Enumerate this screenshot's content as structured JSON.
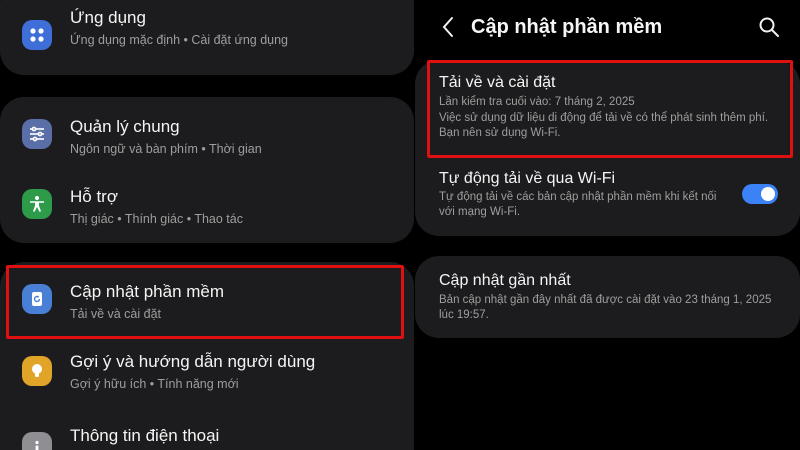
{
  "left": {
    "items": [
      {
        "title": "Ứng dụng",
        "subtitle": "Ứng dụng mặc định • Cài đặt ứng dụng"
      },
      {
        "title": "Quản lý chung",
        "subtitle": "Ngôn ngữ và bàn phím • Thời gian"
      },
      {
        "title": "Hỗ trợ",
        "subtitle": "Thị giác • Thính giác • Thao tác"
      },
      {
        "title": "Cập nhật phần mềm",
        "subtitle": "Tải về và cài đặt"
      },
      {
        "title": "Gợi ý và hướng dẫn người dùng",
        "subtitle": "Gợi ý hữu ích • Tính năng mới"
      },
      {
        "title": "Thông tin điện thoại",
        "subtitle": ""
      }
    ]
  },
  "right": {
    "page_title": "Cập nhật phần mềm",
    "download": {
      "title": "Tải về và cài đặt",
      "last_check": "Lần kiểm tra cuối vào: 7 tháng 2, 2025",
      "note": "Việc sử dụng dữ liệu di động để tải về có thể phát sinh thêm phí. Bạn nên sử dụng Wi-Fi."
    },
    "auto": {
      "title": "Tự động tải về qua Wi-Fi",
      "desc": "Tự động tải về các bản cập nhật phần mềm khi kết nối với mạng Wi-Fi.",
      "toggle_on": true
    },
    "latest": {
      "title": "Cập nhật gần nhất",
      "desc": "Bản cập nhật gần đây nhất đã được cài đặt vào 23 tháng 1, 2025 lúc 19:57."
    }
  },
  "colors": {
    "highlight": "#e01010",
    "apps_icon": "#3e6fd8",
    "general_icon": "#5a6fa8",
    "support_icon": "#2e9b4a",
    "update_icon": "#4a7fd6",
    "tips_icon": "#e0a528",
    "info_icon": "#8e8e93",
    "toggle": "#3b82f6"
  },
  "icons": [
    "apps-icon",
    "sliders-icon",
    "accessibility-icon",
    "update-icon",
    "bulb-icon",
    "info-icon",
    "back-icon",
    "search-icon"
  ]
}
